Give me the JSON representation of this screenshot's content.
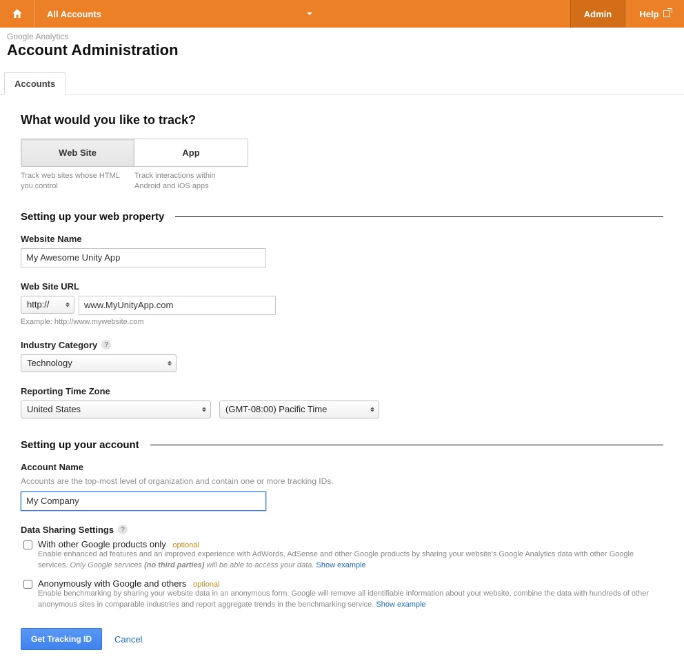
{
  "topbar": {
    "all_accounts": "All Accounts",
    "admin": "Admin",
    "help": "Help"
  },
  "breadcrumb": "Google Analytics",
  "page_title": "Account Administration",
  "tab_accounts": "Accounts",
  "section_q": "What would you like to track?",
  "toggles": {
    "web": {
      "label": "Web Site",
      "desc": "Track web sites whose HTML you control"
    },
    "app": {
      "label": "App",
      "desc": "Track interactions within Android and iOS apps"
    }
  },
  "prop_section": "Setting up your web property",
  "fields": {
    "website_name": {
      "label": "Website Name",
      "value": "My Awesome Unity App"
    },
    "website_url": {
      "label": "Web Site URL",
      "scheme": "http://",
      "value": "www.MyUnityApp.com",
      "example": "Example: http://www.mywebsite.com"
    },
    "industry": {
      "label": "Industry Category",
      "value": "Technology"
    },
    "timezone": {
      "label": "Reporting Time Zone",
      "country": "United States",
      "tz": "(GMT-08:00) Pacific Time"
    }
  },
  "account_section": "Setting up your account",
  "account": {
    "label": "Account Name",
    "sub": "Accounts are the top-most level of organization and contain one or more tracking IDs.",
    "value": "My Company"
  },
  "sharing": {
    "label": "Data Sharing Settings",
    "optional": "optional",
    "opt1": {
      "title": "With other Google products only",
      "desc_a": "Enable enhanced ad features and an improved experience with AdWords, AdSense and other Google products by sharing your website's Google Analytics data with other Google services. ",
      "desc_em": "Only Google services (no third parties) will be able to access your data.",
      "link": "Show example"
    },
    "opt2": {
      "title": "Anonymously with Google and others",
      "desc": "Enable benchmarking by sharing your website data in an anonymous form. Google will remove all identifiable information about your website, combine the data with hundreds of other anonymous sites in comparable industries and report aggregate trends in the benchmarking service. ",
      "link": "Show example"
    }
  },
  "actions": {
    "get_id": "Get Tracking ID",
    "cancel": "Cancel"
  }
}
